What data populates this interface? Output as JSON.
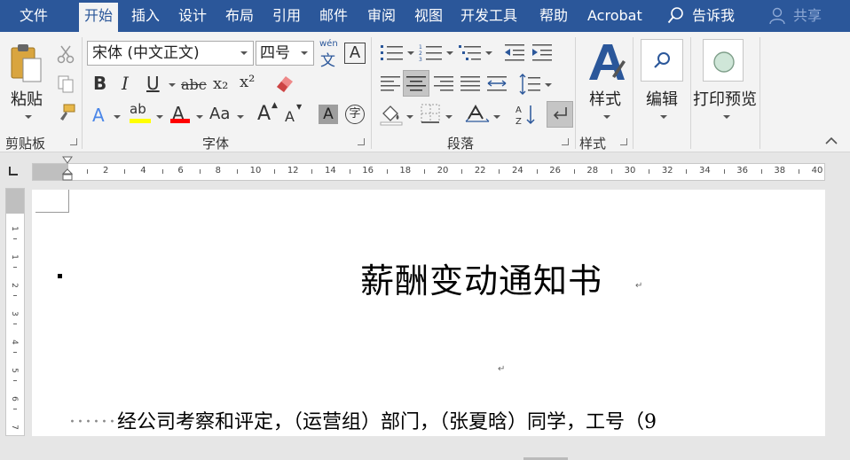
{
  "menu": {
    "tabs": [
      "文件",
      "开始",
      "插入",
      "设计",
      "布局",
      "引用",
      "邮件",
      "审阅",
      "视图",
      "开发工具",
      "帮助",
      "Acrobat"
    ],
    "tell_me": "告诉我",
    "share": "共享"
  },
  "ribbon": {
    "clipboard": {
      "paste_label": "粘贴",
      "group_label": "剪贴板"
    },
    "font": {
      "font_name": "宋体 (中文正文)",
      "font_size": "四号",
      "phonetic_top": "wén",
      "phonetic_bottom": "文",
      "border_char": "A",
      "bold": "B",
      "italic": "I",
      "underline": "U",
      "strike": "abc",
      "subscript": "x₂",
      "superscript": "x²",
      "text_effect": "A",
      "highlight": "ab",
      "font_color": "A",
      "change_case": "Aa",
      "grow": "A",
      "shrink": "A",
      "shading_char": "A",
      "enclose_char": "字",
      "group_label": "字体"
    },
    "paragraph": {
      "group_label": "段落"
    },
    "styles": {
      "label": "样式",
      "group_label": "样式"
    },
    "editing": {
      "label": "编辑"
    },
    "print_preview": {
      "label": "打印预览"
    }
  },
  "ruler": {
    "numbers": [
      "2",
      "4",
      "6",
      "8",
      "10",
      "12",
      "14",
      "16",
      "18",
      "20",
      "22",
      "24",
      "26",
      "28",
      "30",
      "32",
      "34",
      "36",
      "38",
      "40"
    ],
    "vnumbers": [
      "1",
      "1",
      "2",
      "3",
      "4",
      "5",
      "6",
      "7",
      "8"
    ]
  },
  "document": {
    "title": "薪酬变动通知书",
    "body_dots": "······",
    "body_text": "经公司考察和评定，（运营组）部门，（张夏晗）同学，工号（9"
  },
  "colors": {
    "brand": "#2b579a",
    "highlight": "#ffff00",
    "font_red": "#ff0000"
  }
}
